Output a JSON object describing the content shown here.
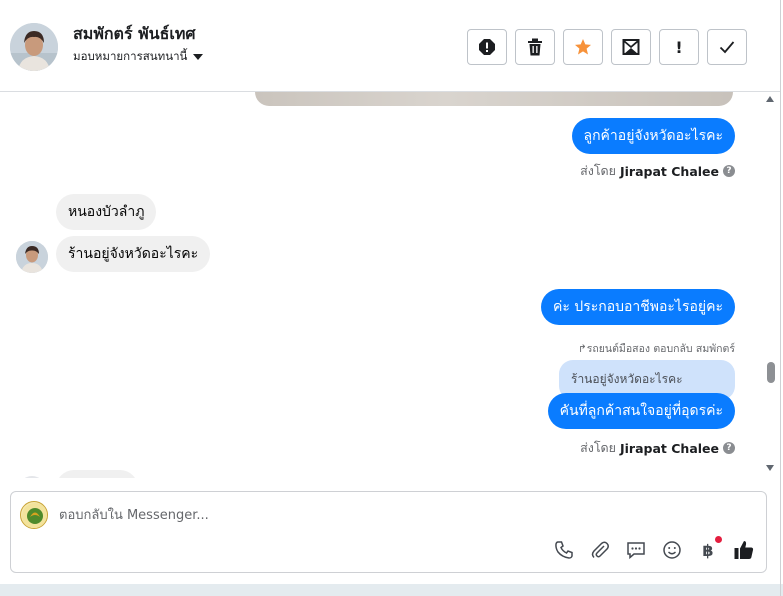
{
  "header": {
    "contact_name": "สมพักตร์ พันธ์เทศ",
    "assign_label": "มอบหมายการสนทนานี้"
  },
  "toolbar": {
    "spam_label": "!",
    "done_label": "✓"
  },
  "messages": [
    {
      "direction": "out",
      "text": "ลูกค้าอยู่จังหวัดอะไรคะ"
    },
    {
      "direction": "in",
      "text": "หนองบัวลำภู"
    },
    {
      "direction": "in",
      "text": "ร้านอยู่จังหวัดอะไรคะ"
    },
    {
      "direction": "out",
      "text": "ค่ะ ประกอบอาชีพอะไรอยู่คะ"
    },
    {
      "direction": "out",
      "text": "คันที่ลูกค้าสนใจอยู่ที่อุดรค่ะ"
    }
  ],
  "sent_by": {
    "prefix": "ส่งโดย",
    "agent": "Jirapat Chalee",
    "help": "?"
  },
  "reply_context": {
    "note": "↱รถยนต์มือสอง ตอบกลับ สมพักตร์",
    "quoted_text": "ร้านอยู่จังหวัดอะไรคะ"
  },
  "composer": {
    "placeholder": "ตอบกลับใน Messenger...",
    "currency_symbol": "฿"
  },
  "colors": {
    "outgoing_bubble": "#0a7cff",
    "incoming_bubble": "#f0f0f0",
    "quoted_bubble": "#cfe2fb",
    "star_active": "#f7923a",
    "notification_dot": "#e41e3f"
  }
}
